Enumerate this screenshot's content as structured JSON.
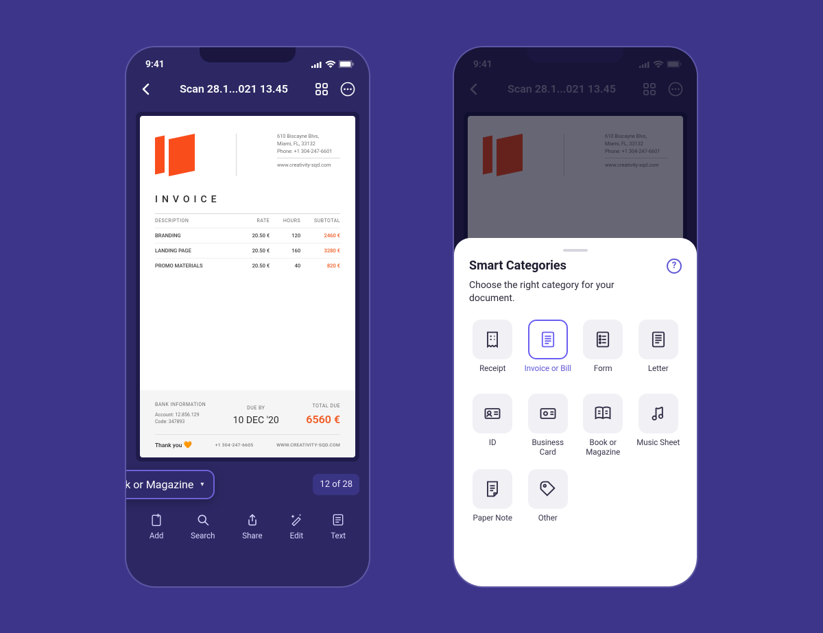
{
  "status_time": "9:41",
  "header": {
    "title": "Scan 28.1...021 13.45"
  },
  "invoice": {
    "company": {
      "addr1": "610 Biscayne Blvs,",
      "addr2": "Miami, FL, 33132",
      "phone": "Phone: +1 304-247-6601",
      "site": "www.creativity-sqd.com"
    },
    "title": "INVOICE",
    "cols": {
      "desc": "DESCRIPTION",
      "rate": "RATE",
      "hours": "HOURS",
      "sub": "SUBTOTAL"
    },
    "rows": [
      {
        "desc": "BRANDING",
        "rate": "20.50 €",
        "hours": "120",
        "sub": "2460 €"
      },
      {
        "desc": "LANDING PAGE",
        "rate": "20.50 €",
        "hours": "160",
        "sub": "3280 €"
      },
      {
        "desc": "PROMO MATERIALS",
        "rate": "20.50 €",
        "hours": "40",
        "sub": "820 €"
      }
    ],
    "footer": {
      "bank_title": "BANK INFORMATION",
      "account": "Account: 12.856.129",
      "code": "Code: 347893",
      "due_label": "DUE BY",
      "due_value": "10 DEC '20",
      "total_label": "TOTAL DUE",
      "total_value": "6560 €",
      "thanks": "Thank you",
      "phone2": "+1 304-247-6605",
      "site2": "WWW.CREATIVITY-SQD.COM"
    }
  },
  "category_pill": "Book or Magazine",
  "page_counter": "12 of 28",
  "toolbar": {
    "add": "Add",
    "search": "Search",
    "share": "Share",
    "edit": "Edit",
    "text": "Text"
  },
  "sheet": {
    "title": "Smart Categories",
    "subtitle": "Choose the right category for your document."
  },
  "categories": [
    {
      "key": "receipt",
      "label": "Receipt"
    },
    {
      "key": "invoice",
      "label": "Invoice or Bill",
      "selected": true
    },
    {
      "key": "form",
      "label": "Form"
    },
    {
      "key": "letter",
      "label": "Letter"
    },
    {
      "key": "id",
      "label": "ID"
    },
    {
      "key": "bizcard",
      "label": "Business Card"
    },
    {
      "key": "book",
      "label": "Book or Magazine"
    },
    {
      "key": "music",
      "label": "Music Sheet"
    },
    {
      "key": "note",
      "label": "Paper Note"
    },
    {
      "key": "other",
      "label": "Other"
    }
  ]
}
